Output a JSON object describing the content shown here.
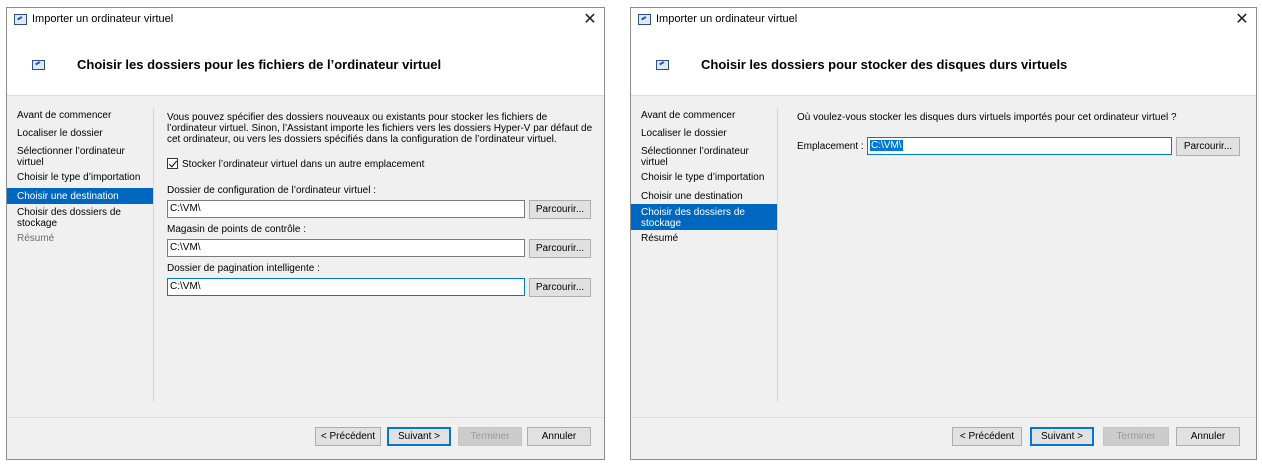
{
  "dialog1": {
    "window_title": "Importer un ordinateur virtuel",
    "close_glyph": "✕",
    "header_title": "Choisir les dossiers pour les fichiers de l’ordinateur virtuel",
    "nav": [
      {
        "label": "Avant de commencer",
        "state": "normal"
      },
      {
        "label": "Localiser le dossier",
        "state": "normal"
      },
      {
        "label": "Sélectionner l’ordinateur virtuel",
        "state": "normal"
      },
      {
        "label": "Choisir le type d’importation",
        "state": "normal"
      },
      {
        "label": "Choisir une destination",
        "state": "active"
      },
      {
        "label": "Choisir des dossiers de stockage",
        "state": "normal"
      },
      {
        "label": "Résumé",
        "state": "disabled"
      }
    ],
    "description": "Vous pouvez spécifier des dossiers nouveaux ou existants pour stocker les fichiers de l’ordinateur virtuel. Sinon, l’Assistant importe les fichiers vers les dossiers Hyper-V par défaut de cet ordinateur, ou vers les dossiers spécifiés dans la configuration de l’ordinateur virtuel.",
    "checkbox_label": "Stocker l’ordinateur virtuel dans un autre emplacement",
    "checkbox_checked": true,
    "fields": [
      {
        "label": "Dossier de configuration de l’ordinateur virtuel :",
        "value": "C:\\VM\\",
        "browse": "Parcourir..."
      },
      {
        "label": "Magasin de points de contrôle :",
        "value": "C:\\VM\\",
        "browse": "Parcourir..."
      },
      {
        "label": "Dossier de pagination intelligente :",
        "value": "C:\\VM\\",
        "browse": "Parcourir..."
      }
    ],
    "buttons": {
      "previous": "< Précédent",
      "next": "Suivant >",
      "finish": "Terminer",
      "cancel": "Annuler"
    }
  },
  "dialog2": {
    "window_title": "Importer un ordinateur virtuel",
    "close_glyph": "✕",
    "header_title": "Choisir les dossiers pour stocker des disques durs virtuels",
    "nav": [
      {
        "label": "Avant de commencer",
        "state": "normal"
      },
      {
        "label": "Localiser le dossier",
        "state": "normal"
      },
      {
        "label": "Sélectionner l’ordinateur virtuel",
        "state": "normal"
      },
      {
        "label": "Choisir le type d’importation",
        "state": "normal"
      },
      {
        "label": "Choisir une destination",
        "state": "normal"
      },
      {
        "label": "Choisir des dossiers de stockage",
        "state": "active"
      },
      {
        "label": "Résumé",
        "state": "normal"
      }
    ],
    "question": "Où voulez-vous stocker les disques durs virtuels importés pour cet ordinateur virtuel ?",
    "location_label": "Emplacement :",
    "location_value": "C:\\VM\\",
    "browse": "Parcourir...",
    "buttons": {
      "previous": "< Précédent",
      "next": "Suivant >",
      "finish": "Terminer",
      "cancel": "Annuler"
    }
  },
  "colors": {
    "accent": "#0067c0",
    "dialog_bg": "#f0f0f0",
    "header_bg": "#ffffff"
  },
  "icons": {
    "app": "virtual-machine-import-icon",
    "close": "close-icon",
    "checkbox": "checkmark-icon"
  }
}
